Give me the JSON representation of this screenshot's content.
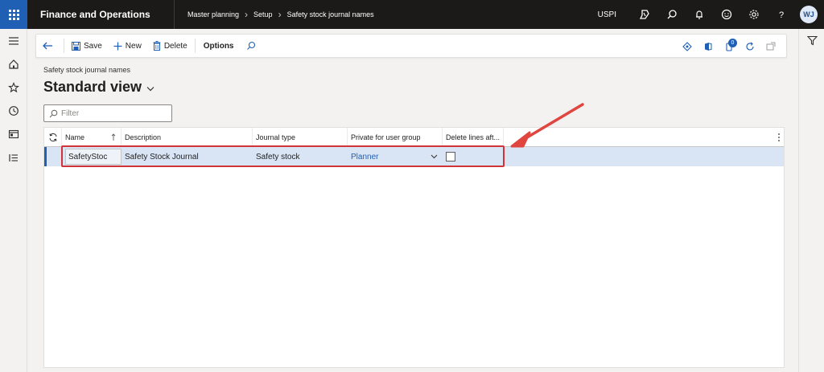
{
  "topbar": {
    "app_title": "Finance and Operations",
    "breadcrumb": [
      "Master planning",
      "Setup",
      "Safety stock journal names"
    ],
    "company": "USPI",
    "avatar_initials": "WJ"
  },
  "actions": {
    "save": "Save",
    "new": "New",
    "delete": "Delete",
    "options": "Options",
    "notification_count": "0"
  },
  "page": {
    "caption": "Safety stock journal names",
    "view": "Standard view",
    "filter_placeholder": "Filter"
  },
  "grid": {
    "columns": [
      "Name",
      "Description",
      "Journal type",
      "Private for user group",
      "Delete lines aft..."
    ],
    "rows": [
      {
        "name": "SafetyStoc",
        "description": "Safety Stock Journal",
        "journal_type": "Safety stock",
        "user_group": "Planner",
        "delete_lines": false
      }
    ]
  },
  "colors": {
    "accent": "#1f5fb4",
    "annotation": "#d13438",
    "selected_row": "#d9e5f5"
  }
}
